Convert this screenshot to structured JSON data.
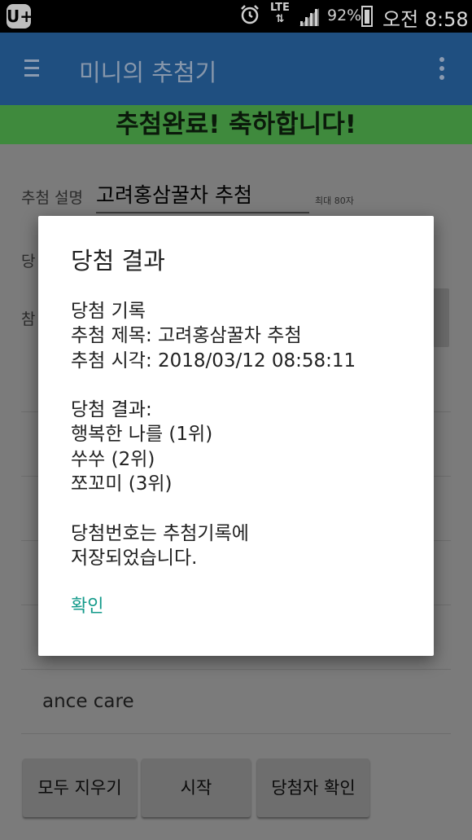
{
  "status_bar": {
    "app_icon": "U+",
    "network": "LTE",
    "battery": "92%",
    "time": "오전 8:58"
  },
  "app_bar": {
    "title": "미니의 추첨기"
  },
  "banner": {
    "text": "추첨완료! 축하합니다!"
  },
  "form": {
    "description_label": "추첨 설명",
    "description_value": "고려홍삼꿀차 추첨",
    "max_hint": "최대 80자",
    "partial_label_1": "당",
    "partial_label_2": "참"
  },
  "list": {
    "visible_item": "ance care"
  },
  "buttons": {
    "clear": "모두 지우기",
    "start": "시작",
    "check_winner": "당첨자 확인"
  },
  "dialog": {
    "title": "당첨 결과",
    "lines": [
      "당첨 기록",
      "추첨 제목: 고려홍삼꿀차 추첨",
      "추첨 시각: 2018/03/12 08:58:11",
      "",
      "당첨 결과:",
      "행복한 나를 (1위)",
      "쑤쑤 (2위)",
      "쪼꼬미 (3위)",
      "",
      "당첨번호는 추첨기록에",
      "저장되었습니다."
    ],
    "ok_label": "확인"
  }
}
